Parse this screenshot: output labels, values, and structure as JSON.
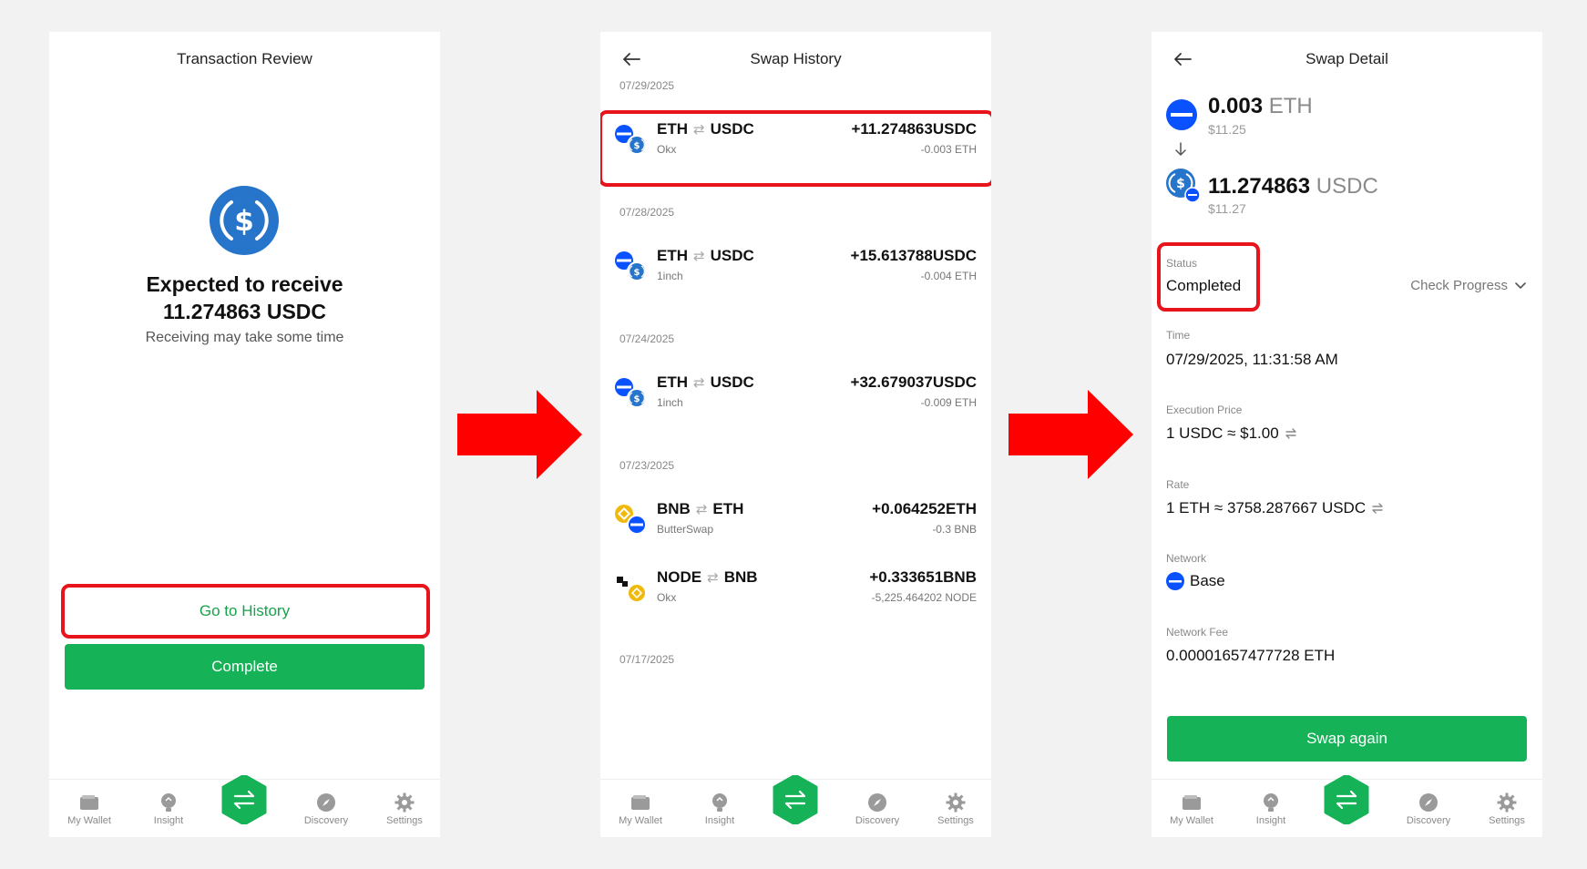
{
  "colors": {
    "green": "#16b257",
    "red_annotation": "#e8141b",
    "eth_blue": "#0a52ff",
    "usdc_blue": "#2775ca",
    "bnb_yellow": "#f0b90b"
  },
  "nav": {
    "items": [
      {
        "label": "My Wallet",
        "icon": "wallet-icon"
      },
      {
        "label": "Insight",
        "icon": "lightbulb-icon"
      },
      {
        "label": "",
        "icon": "swap-icon"
      },
      {
        "label": "Discovery",
        "icon": "compass-icon"
      },
      {
        "label": "Settings",
        "icon": "gear-icon"
      }
    ]
  },
  "review": {
    "title": "Transaction Review",
    "expected_line1": "Expected to receive",
    "expected_line2": "11.274863 USDC",
    "subtitle": "Receiving may take some time",
    "history_button": "Go to History",
    "complete_button": "Complete"
  },
  "history": {
    "title": "Swap History",
    "groups": [
      {
        "date": "07/29/2025",
        "rows": [
          {
            "from": "ETH",
            "to": "USDC",
            "source": "Okx",
            "amount": "+11.274863",
            "amount_unit": "USDC",
            "spent": "-0.003 ETH"
          }
        ]
      },
      {
        "date": "07/28/2025",
        "rows": [
          {
            "from": "ETH",
            "to": "USDC",
            "source": "1inch",
            "amount": "+15.613788",
            "amount_unit": "USDC",
            "spent": "-0.004 ETH"
          }
        ]
      },
      {
        "date": "07/24/2025",
        "rows": [
          {
            "from": "ETH",
            "to": "USDC",
            "source": "1inch",
            "amount": "+32.679037",
            "amount_unit": "USDC",
            "spent": "-0.009 ETH"
          }
        ]
      },
      {
        "date": "07/23/2025",
        "rows": [
          {
            "from": "BNB",
            "to": "ETH",
            "source": "ButterSwap",
            "amount": "+0.064252",
            "amount_unit": "ETH",
            "spent": "-0.3 BNB"
          },
          {
            "from": "NODE",
            "to": "BNB",
            "source": "Okx",
            "amount": "+0.333651",
            "amount_unit": "BNB",
            "spent": "-5,225.464202 NODE"
          }
        ]
      },
      {
        "date": "07/17/2025",
        "rows": []
      }
    ]
  },
  "detail": {
    "title": "Swap Detail",
    "from_amount": "0.003",
    "from_unit": "ETH",
    "from_usd": "$11.25",
    "to_amount": "11.274863",
    "to_unit": "USDC",
    "to_usd": "$11.27",
    "status_label": "Status",
    "status_value": "Completed",
    "check_progress": "Check Progress",
    "time_label": "Time",
    "time_value": "07/29/2025, 11:31:58 AM",
    "exec_label": "Execution Price",
    "exec_value": "1 USDC ≈ $1.00",
    "rate_label": "Rate",
    "rate_value": "1 ETH ≈ 3758.287667 USDC",
    "network_label": "Network",
    "network_value": "Base",
    "fee_label": "Network Fee",
    "fee_value": "0.00001657477728 ETH",
    "swap_again": "Swap again"
  }
}
